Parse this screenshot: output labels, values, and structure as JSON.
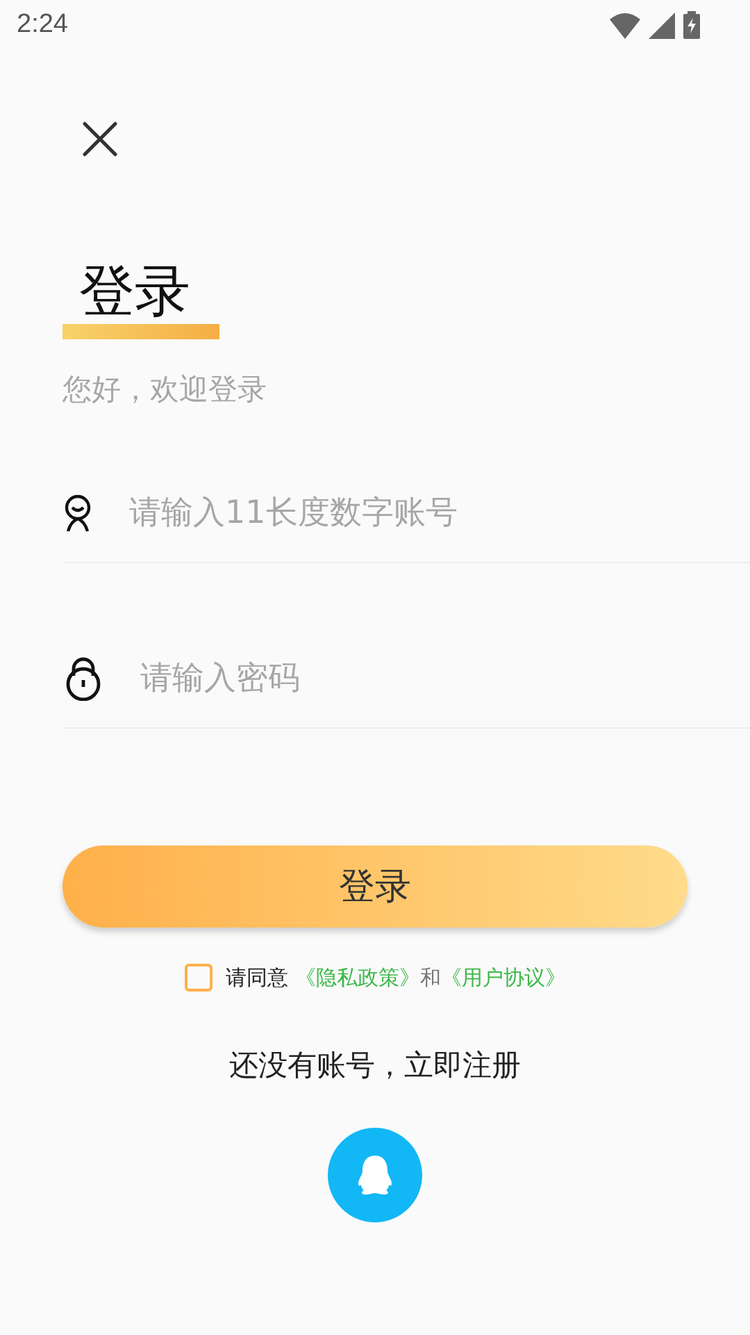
{
  "status_bar": {
    "time": "2:24"
  },
  "title": "登录",
  "subtitle": "您好，欢迎登录",
  "fields": [
    {
      "kind": "account",
      "placeholder": "请输入11长度数字账号"
    },
    {
      "kind": "password",
      "placeholder": "请输入密码"
    }
  ],
  "login_button": "登录",
  "agreement": {
    "checked": false,
    "prefix": "请同意",
    "privacy_link": "《隐私政策》",
    "conjunction": "和",
    "terms_link": "《用户协议》"
  },
  "register_link": "还没有账号，立即注册"
}
